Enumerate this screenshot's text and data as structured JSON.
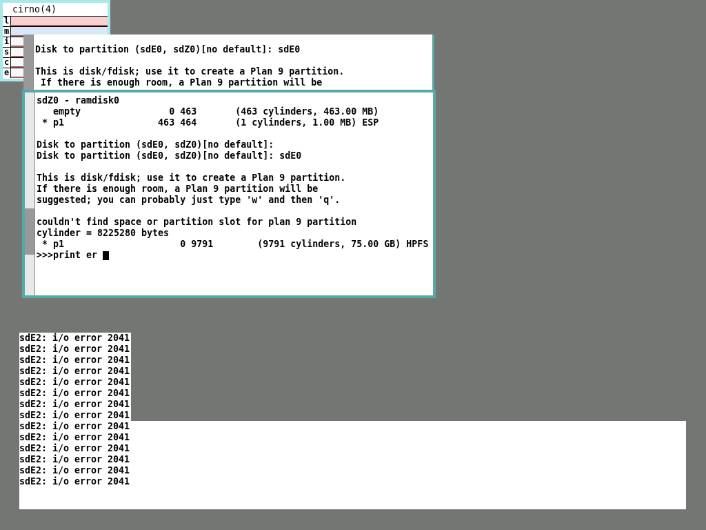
{
  "stats_window": {
    "title": "cirno(4)",
    "meters": [
      {
        "label": "l",
        "color": "#f8d0d0"
      },
      {
        "label": "m",
        "color": "#d8e8f8"
      },
      {
        "label": "i",
        "color": "#f8f8f8"
      },
      {
        "label": "s",
        "color": "#f8f8f8"
      },
      {
        "label": "c",
        "color": "#f8f8f8"
      },
      {
        "label": "e",
        "color": "#f8f8f8"
      }
    ]
  },
  "back_window": {
    "blocks": [
      [
        "Disk to partition (sdE0, sdZ0)[no default]: sdE0"
      ],
      [
        "This is disk/fdisk; use it to create a Plan 9 partition.",
        " If there is enough room, a Plan 9 partition will be"
      ]
    ]
  },
  "front_window": {
    "blocks": [
      [
        "sdZ0 - ramdisk0",
        "   empty                0 463       (463 cylinders, 463.00 MB)",
        " * p1                 463 464       (1 cylinders, 1.00 MB) ESP"
      ],
      [
        "Disk to partition (sdE0, sdZ0)[no default]:",
        "Disk to partition (sdE0, sdZ0)[no default]: sdE0"
      ],
      [
        "This is disk/fdisk; use it to create a Plan 9 partition.",
        "If there is enough room, a Plan 9 partition will be",
        "suggested; you can probably just type 'w' and then 'q'."
      ],
      [
        "couldn't find space or partition slot for plan 9 partition",
        "cylinder = 8225280 bytes",
        " * p1                     0 9791        (9791 cylinders, 75.00 GB) HPFS"
      ]
    ],
    "prompt": ">>>print er"
  },
  "console": {
    "lines_above": [
      "sdE2: i/o error 2041",
      "sdE2: i/o error 2041",
      "sdE2: i/o error 2041",
      "sdE2: i/o error 2041",
      "sdE2: i/o error 2041",
      "sdE2: i/o error 2041",
      "sdE2: i/o error 2041",
      "sdE2: i/o error 2041"
    ],
    "panel_lines": [
      "sdE2: i/o error 2041",
      "sdE2: i/o error 2041",
      "sdE2: i/o error 2041",
      "sdE2: i/o error 2041",
      "sdE2: i/o error 2041",
      "sdE2: i/o error 2041"
    ]
  }
}
